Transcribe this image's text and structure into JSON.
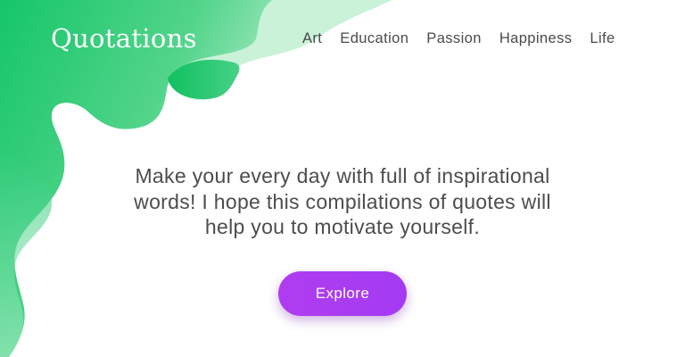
{
  "brand": {
    "logo_text": "Quotations"
  },
  "nav": {
    "items": [
      "Art",
      "Education",
      "Passion",
      "Happiness",
      "Life"
    ]
  },
  "hero": {
    "tagline": "Make your every day with full of inspirational words! I hope this compilations of quotes will help you to motivate yourself.",
    "cta_label": "Explore"
  },
  "theme": {
    "green_primary": "#1dc96b",
    "green_light": "#c9f2d9",
    "accent_purple": "#a93cf1",
    "text_color": "#4d4d4d"
  }
}
